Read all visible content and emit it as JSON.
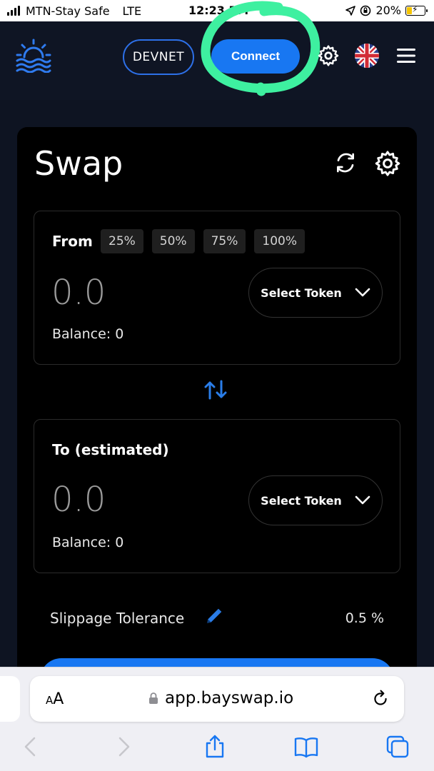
{
  "status_bar": {
    "carrier": "MTN-Stay Safe",
    "network": "LTE",
    "time": "12:23 PM",
    "battery": "20%"
  },
  "header": {
    "network_badge": "DEVNET",
    "connect_label": "Connect",
    "annotation_color": "#3ef0a0",
    "accent_color": "#1877f2",
    "icons": [
      "sun-waves-logo-icon",
      "gear-icon",
      "uk-flag-icon",
      "hamburger-menu-icon"
    ]
  },
  "swap": {
    "title": "Swap",
    "from": {
      "label": "From",
      "percent_buttons": [
        "25%",
        "50%",
        "75%",
        "100%"
      ],
      "amount": "0.0",
      "select_token": "Select Token",
      "balance": "Balance: 0"
    },
    "to": {
      "label": "To (estimated)",
      "amount": "0.0",
      "select_token": "Select Token",
      "balance": "Balance: 0"
    },
    "slippage": {
      "label": "Slippage Tolerance",
      "value": "0.5 %"
    }
  },
  "browser": {
    "aa_label": "AA",
    "url": "app.bayswap.io"
  }
}
